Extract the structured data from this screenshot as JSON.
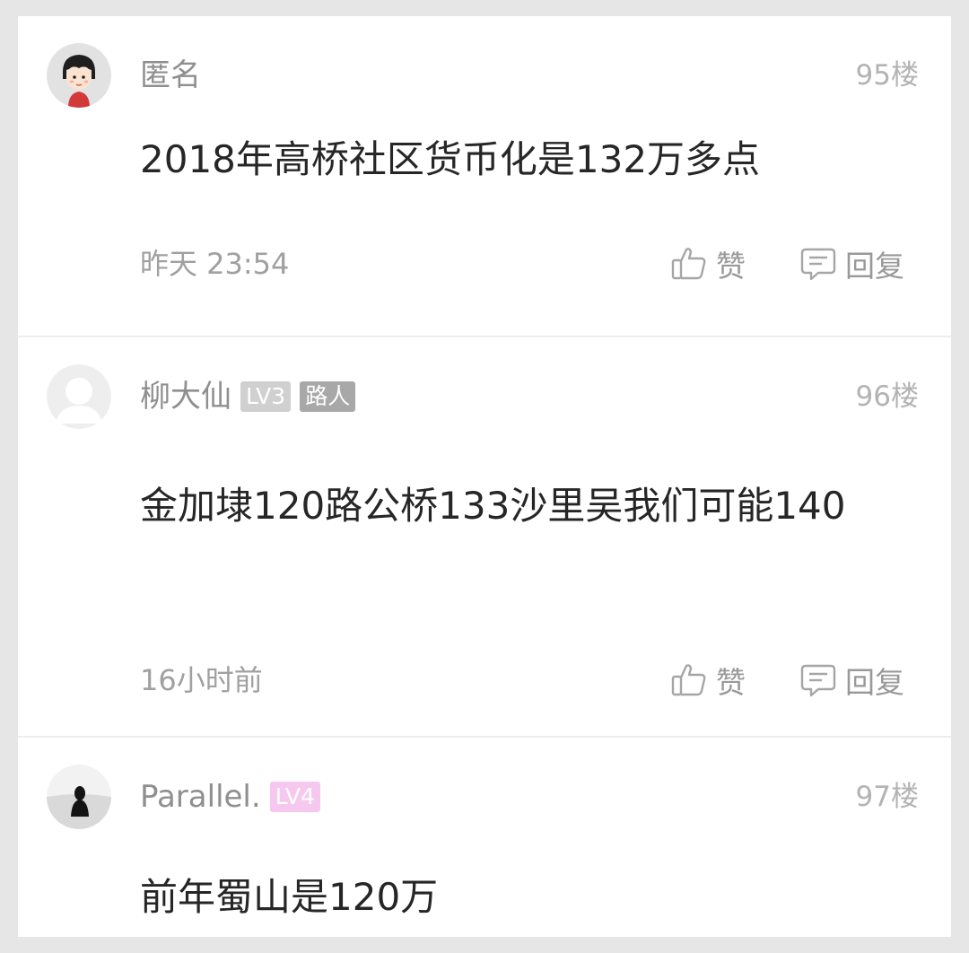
{
  "comments": [
    {
      "username": "匿名",
      "floor": "95楼",
      "content": "2018年高桥社区货币化是132万多点",
      "time": "昨天 23:54",
      "avatar": "cartoon-girl-avatar",
      "like_label": "赞",
      "reply_label": "回复"
    },
    {
      "username": "柳大仙",
      "level_badge": "LV3",
      "role_badge": "路人",
      "floor": "96楼",
      "content": "金加埭120路公桥133沙里吴我们可能140",
      "time": "16小时前",
      "avatar": "default-user-avatar",
      "like_label": "赞",
      "reply_label": "回复"
    },
    {
      "username": "Parallel.",
      "level_badge": "LV4",
      "floor": "97楼",
      "content": "前年蜀山是120万",
      "avatar": "silhouette-photo-avatar"
    }
  ],
  "colors": {
    "page_background": "#e6e6e6",
    "card_background": "#ffffff",
    "username": "#8f8f8f",
    "content": "#262626",
    "meta": "#a0a0a0",
    "badge_grey": "#d0d0d0",
    "badge_role": "#a8a8a8",
    "badge_pink": "#f6c8ef"
  },
  "icons": {
    "like": "thumbs-up-icon",
    "reply": "comment-bubble-icon"
  }
}
